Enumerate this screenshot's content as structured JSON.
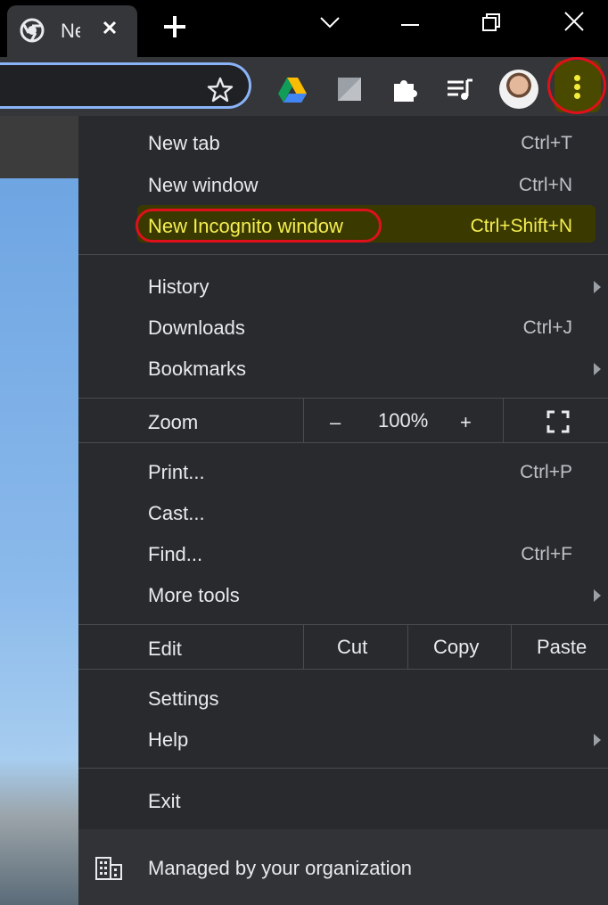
{
  "browser": {
    "tab_title": "New Tab",
    "tab_title_visible": "Ne",
    "colors": {
      "accent": "#8ab4f8",
      "highlight_ring": "#e0101a",
      "highlight_fill": "#3a3a00",
      "menu_bg": "#292a2d"
    }
  },
  "toolbar": {
    "icons": [
      "bookmark-star-icon",
      "google-drive-icon",
      "gray-square-extension-icon",
      "extensions-puzzle-icon",
      "media-queue-icon",
      "profile-avatar",
      "chrome-menu-icon"
    ]
  },
  "menu": {
    "new_tab": {
      "label": "New tab",
      "shortcut": "Ctrl+T"
    },
    "new_window": {
      "label": "New window",
      "shortcut": "Ctrl+N"
    },
    "new_incognito": {
      "label": "New Incognito window",
      "shortcut": "Ctrl+Shift+N"
    },
    "history": {
      "label": "History"
    },
    "downloads": {
      "label": "Downloads",
      "shortcut": "Ctrl+J"
    },
    "bookmarks": {
      "label": "Bookmarks"
    },
    "zoom": {
      "label": "Zoom",
      "minus": "–",
      "value": "100%",
      "plus": "+"
    },
    "print": {
      "label": "Print...",
      "shortcut": "Ctrl+P"
    },
    "cast": {
      "label": "Cast..."
    },
    "find": {
      "label": "Find...",
      "shortcut": "Ctrl+F"
    },
    "more_tools": {
      "label": "More tools"
    },
    "edit": {
      "label": "Edit",
      "cut": "Cut",
      "copy": "Copy",
      "paste": "Paste"
    },
    "settings": {
      "label": "Settings"
    },
    "help": {
      "label": "Help"
    },
    "exit": {
      "label": "Exit"
    },
    "managed": {
      "label": "Managed by your organization"
    }
  }
}
